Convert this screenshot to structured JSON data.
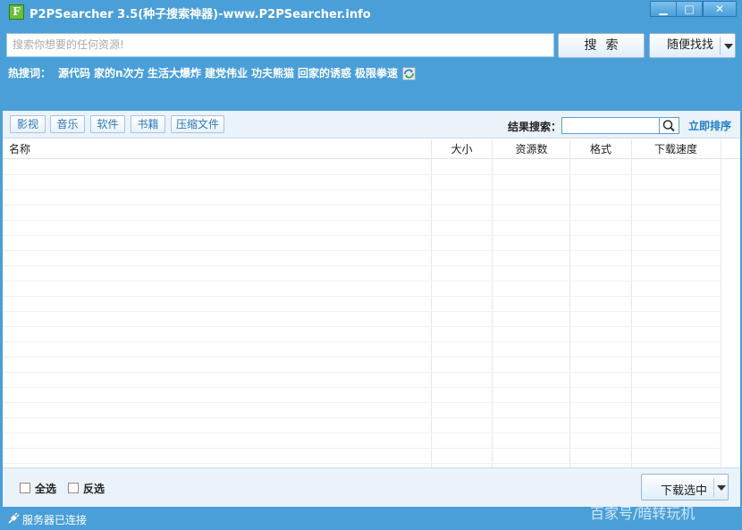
{
  "window": {
    "icon_letter": "F",
    "title": "P2PSearcher 3.5(种子搜索神器)-www.P2PSearcher.info",
    "min_glyph": "▁",
    "max_glyph": "□",
    "close_glyph": "✕"
  },
  "search": {
    "placeholder": "搜索你想要的任何资源!",
    "search_button": "搜索",
    "random_button": "随便找找"
  },
  "hot": {
    "label": "热搜词：",
    "items": [
      "源代码",
      "家的n次方",
      "生活大爆炸",
      "建党伟业",
      "功夫熊猫",
      "回家的诱惑",
      "极限拳速"
    ]
  },
  "categories": [
    "影视",
    "音乐",
    "软件",
    "书籍",
    "压缩文件"
  ],
  "result_search": {
    "label": "结果搜索：",
    "value": "",
    "sort_link": "立即排序"
  },
  "table": {
    "columns": [
      "名称",
      "大小",
      "资源数",
      "格式",
      "下载速度"
    ],
    "rows": []
  },
  "footer": {
    "select_all": "全选",
    "invert": "反选",
    "download_button": "下载选中"
  },
  "status": {
    "text": "服务器已连接"
  },
  "watermark": "百家号/暗转玩机",
  "colors": {
    "accent": "#4a9fd8",
    "link": "#1f7fc8"
  },
  "icons": [
    "app-logo-icon",
    "refresh-icon",
    "magnifier-icon",
    "chevron-down-icon",
    "plug-icon"
  ]
}
